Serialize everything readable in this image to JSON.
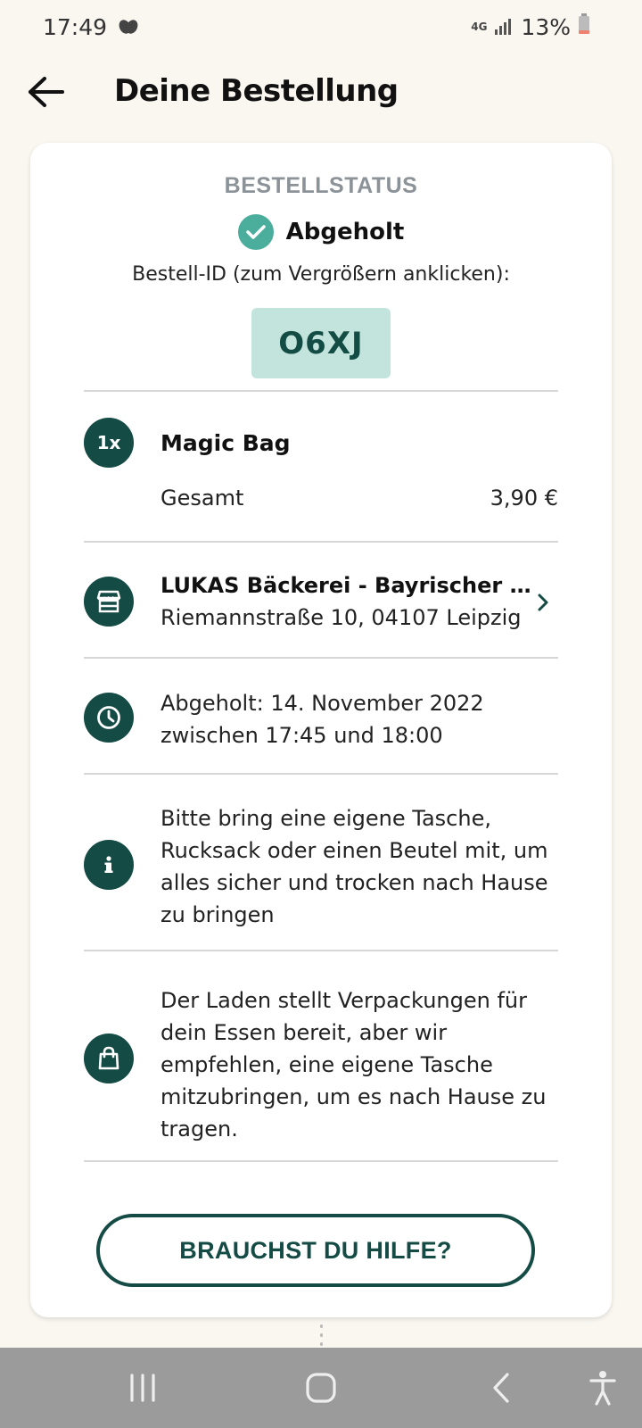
{
  "status_bar": {
    "time": "17:49",
    "network": "4G",
    "battery": "13%"
  },
  "header": {
    "title": "Deine Bestellung"
  },
  "order": {
    "status_label": "BESTELLSTATUS",
    "status_value": "Abgeholt",
    "id_label": "Bestell-ID (zum Vergrößern anklicken):",
    "id": "O6XJ"
  },
  "item": {
    "quantity": "1x",
    "name": "Magic Bag",
    "total_label": "Gesamt",
    "total_value": "3,90 €"
  },
  "store": {
    "name": "LUKAS Bäckerei - Bayrischer Bahnhof",
    "address": "Riemannstraße 10, 04107 Leipzig"
  },
  "pickup": {
    "line1": "Abgeholt: 14. November 2022",
    "line2": "zwischen 17:45 und 18:00"
  },
  "info": {
    "bag_hint": "Bitte bring eine eigene Tasche, Rucksack oder einen Beutel mit, um alles sicher und trocken nach Hause zu bringen",
    "packaging_hint": "Der Laden stellt Verpackungen für dein Essen bereit, aber wir empfehlen, eine eigene Tasche mitzubringen, um es nach Hause zu tragen."
  },
  "help_button": "BRAUCHST DU HILFE?",
  "colors": {
    "background": "#faf7f1",
    "primary_dark": "#144b45",
    "accent_teal": "#4bae9d",
    "id_box": "#c3e4dd",
    "nav_bar": "#9b9b9b"
  }
}
